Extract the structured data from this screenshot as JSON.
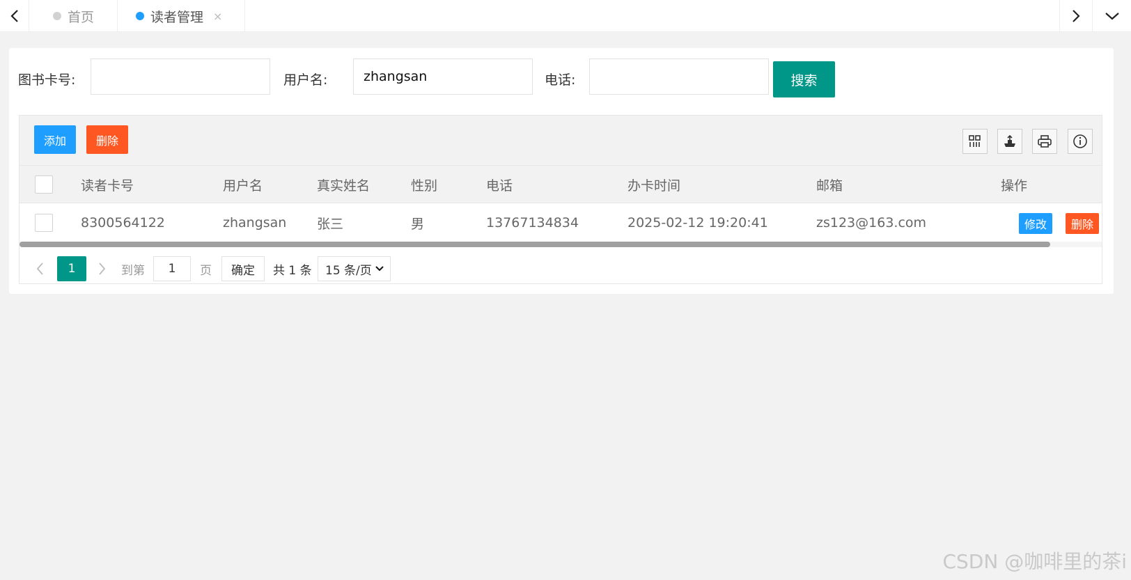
{
  "tabs": [
    {
      "label": "首页",
      "active": false
    },
    {
      "label": "读者管理",
      "active": true
    }
  ],
  "tab_close": "×",
  "search": {
    "card_label": "图书卡号:",
    "card_value": "",
    "username_label": "用户名:",
    "username_value": "zhangsan",
    "phone_label": "电话:",
    "phone_value": "",
    "button": "搜索"
  },
  "toolbar": {
    "add": "添加",
    "delete": "删除"
  },
  "table": {
    "columns": [
      "读者卡号",
      "用户名",
      "真实姓名",
      "性别",
      "电话",
      "办卡时间",
      "邮箱",
      "操作"
    ],
    "rows": [
      {
        "card": "8300564122",
        "username": "zhangsan",
        "realname": "张三",
        "gender": "男",
        "phone": "13767134834",
        "time": "2025-02-12 19:20:41",
        "email": "zs123@163.com",
        "edit": "修改",
        "delete": "删除"
      }
    ]
  },
  "pager": {
    "current": "1",
    "goto": "到第",
    "page_input": "1",
    "page_unit": "页",
    "confirm": "确定",
    "total": "共 1 条",
    "page_size": "15 条/页"
  },
  "watermark": "CSDN @咖啡里的茶i",
  "colors": {
    "primary": "#009688",
    "blue": "#1e9fff",
    "red": "#ff5722"
  }
}
